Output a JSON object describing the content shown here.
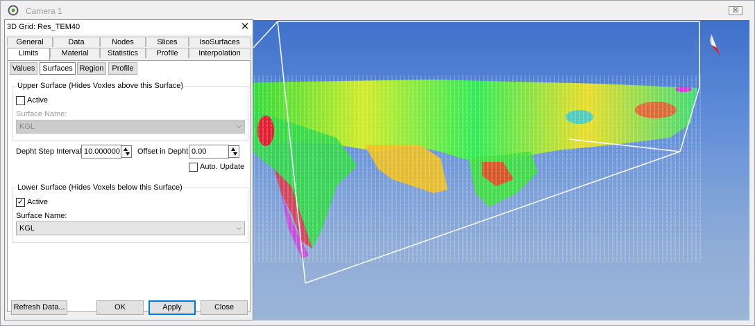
{
  "window": {
    "title": "Camera 1",
    "close_glyph": "☒"
  },
  "dialog": {
    "title": "3D Grid: Res_TEM40",
    "close_glyph": "✕",
    "tabs_row1": [
      "General",
      "Data",
      "Nodes",
      "Slices",
      "IsoSurfaces"
    ],
    "tabs_row2": [
      "Limits",
      "Material",
      "Statistics",
      "Profile",
      "Interpolation"
    ],
    "active_tab": "Limits",
    "subtabs": [
      "Values",
      "Surfaces",
      "Region",
      "Profile"
    ],
    "active_subtab": "Surfaces",
    "upper": {
      "group_label": "Upper Surface (Hides Voxles above this Surface)",
      "active_label": "Active",
      "active_checked": false,
      "surface_name_label": "Surface Name:",
      "surface_name_value": "KGL"
    },
    "depth_step_label": "Depht Step Interval",
    "depth_step_value": "10.000000",
    "offset_label": "Offset in Depht",
    "offset_value": "0.00",
    "auto_update_label": "Auto. Update",
    "auto_update_checked": false,
    "lower": {
      "group_label": "Lower Surface (Hides Voxels below this Surface)",
      "active_label": "Active",
      "active_checked": true,
      "surface_name_label": "Surface Name:",
      "surface_name_value": "KGL"
    },
    "buttons": {
      "refresh": "Refresh Data...",
      "ok": "OK",
      "apply": "Apply",
      "close": "Close"
    }
  },
  "icons": {
    "app": "app-logo-icon",
    "compass": "north-arrow-icon",
    "dropdown": "chevron-down-icon",
    "spinner": "spin-updown-icon",
    "check": "✓",
    "chevron": "⌵"
  },
  "colors": {
    "sky_top": "#3e71ca",
    "sky_bottom": "#9bb5d8",
    "accent": "#0078d7"
  }
}
